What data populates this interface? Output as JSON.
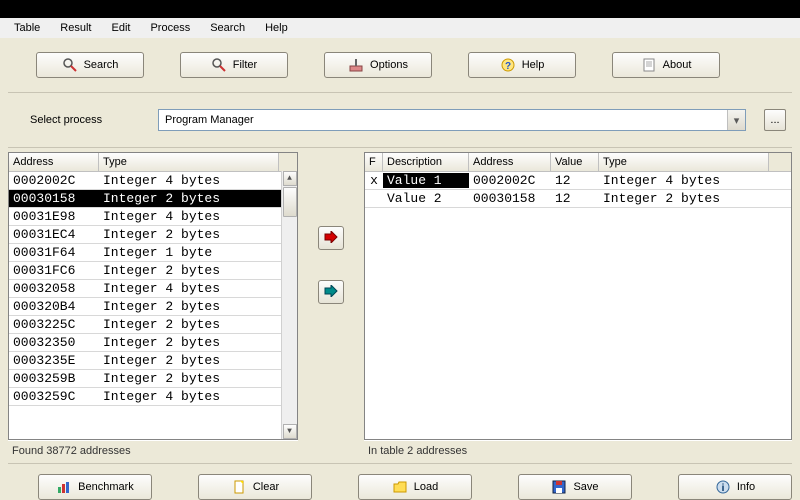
{
  "menu": {
    "items": [
      "Table",
      "Result",
      "Edit",
      "Process",
      "Search",
      "Help"
    ]
  },
  "toolbar": {
    "search": "Search",
    "filter": "Filter",
    "options": "Options",
    "help": "Help",
    "about": "About"
  },
  "process": {
    "label": "Select process",
    "value": "Program Manager",
    "browse": "..."
  },
  "left_list": {
    "columns": [
      "Address",
      "Type"
    ],
    "rows": [
      {
        "addr": "0002002C",
        "type": "Integer 4 bytes",
        "sel": false
      },
      {
        "addr": "00030158",
        "type": "Integer 2 bytes",
        "sel": true
      },
      {
        "addr": "00031E98",
        "type": "Integer 4 bytes",
        "sel": false
      },
      {
        "addr": "00031EC4",
        "type": "Integer 2 bytes",
        "sel": false
      },
      {
        "addr": "00031F64",
        "type": "Integer 1 byte",
        "sel": false
      },
      {
        "addr": "00031FC6",
        "type": "Integer 2 bytes",
        "sel": false
      },
      {
        "addr": "00032058",
        "type": "Integer 4 bytes",
        "sel": false
      },
      {
        "addr": "000320B4",
        "type": "Integer 2 bytes",
        "sel": false
      },
      {
        "addr": "0003225C",
        "type": "Integer 2 bytes",
        "sel": false
      },
      {
        "addr": "00032350",
        "type": "Integer 2 bytes",
        "sel": false
      },
      {
        "addr": "0003235E",
        "type": "Integer 2 bytes",
        "sel": false
      },
      {
        "addr": "0003259B",
        "type": "Integer 2 bytes",
        "sel": false
      },
      {
        "addr": "0003259C",
        "type": "Integer 4 bytes",
        "sel": false
      }
    ],
    "status": "Found 38772 addresses"
  },
  "right_list": {
    "columns": [
      "F",
      "Description",
      "Address",
      "Value",
      "Type"
    ],
    "rows": [
      {
        "f": "x",
        "desc": "Value 1",
        "addr": "0002002C",
        "val": "12",
        "type": "Integer 4 bytes",
        "seldesc": true
      },
      {
        "f": "",
        "desc": "Value 2",
        "addr": "00030158",
        "val": "12",
        "type": "Integer 2 bytes",
        "seldesc": false
      }
    ],
    "status": "In table 2 addresses"
  },
  "bottom": {
    "benchmark": "Benchmark",
    "clear": "Clear",
    "load": "Load",
    "save": "Save",
    "info": "Info"
  }
}
